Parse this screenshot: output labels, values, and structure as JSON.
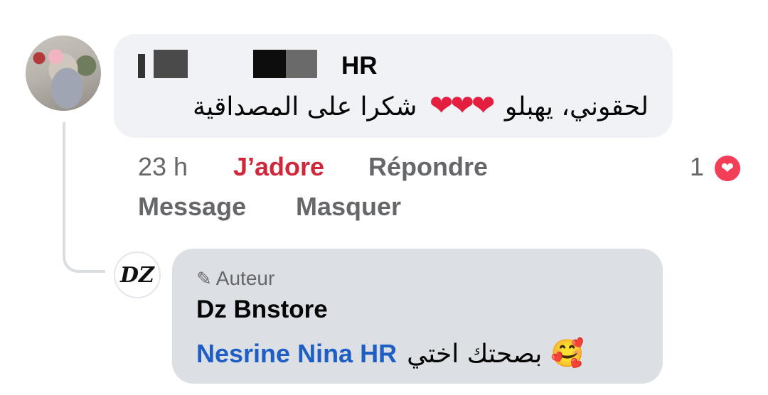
{
  "comment": {
    "author_visible_suffix": "HR",
    "text_before": "لحقوني، يهبلو",
    "hearts": "❤❤❤",
    "text_after": "شكرا على المصداقية",
    "timestamp": "23 h",
    "like_label": "J’adore",
    "reply_label": "Répondre",
    "message_label": "Message",
    "hide_label": "Masquer",
    "reaction_count": "1"
  },
  "reply": {
    "avatar_initials": "DZ",
    "badge_label": "Auteur",
    "author": "Dz Bnstore",
    "mention": "Nesrine Nina HR",
    "text": "بصحتك اختي",
    "emoji": "🥰"
  },
  "colors": {
    "like_red": "#d0283a",
    "mention_blue": "#1f5fc4",
    "heart_red": "#e41e3f",
    "bubble_gray": "#f0f2f5",
    "reply_bubble_gray": "#dcdfe3"
  },
  "icons": {
    "reaction": "heart-reaction-icon",
    "badge": "pencil-icon",
    "emoji": "smiling-face-with-hearts-icon"
  }
}
